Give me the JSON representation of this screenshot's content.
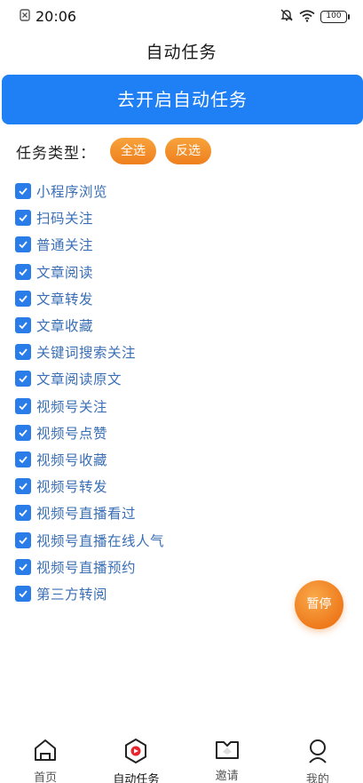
{
  "status_bar": {
    "time": "20:06",
    "battery": "100"
  },
  "header": {
    "title": "自动任务"
  },
  "start_button": {
    "label": "去开启自动任务"
  },
  "task_types": {
    "label": "任务类型：",
    "select_all": "全选",
    "invert": "反选"
  },
  "tasks": [
    {
      "label": "小程序浏览",
      "checked": true
    },
    {
      "label": "扫码关注",
      "checked": true
    },
    {
      "label": "普通关注",
      "checked": true
    },
    {
      "label": "文章阅读",
      "checked": true
    },
    {
      "label": "文章转发",
      "checked": true
    },
    {
      "label": "文章收藏",
      "checked": true
    },
    {
      "label": "关键词搜索关注",
      "checked": true
    },
    {
      "label": "文章阅读原文",
      "checked": true
    },
    {
      "label": "视频号关注",
      "checked": true
    },
    {
      "label": "视频号点赞",
      "checked": true
    },
    {
      "label": "视频号收藏",
      "checked": true
    },
    {
      "label": "视频号转发",
      "checked": true
    },
    {
      "label": "视频号直播看过",
      "checked": true
    },
    {
      "label": "视频号直播在线人气",
      "checked": true
    },
    {
      "label": "视频号直播预约",
      "checked": true
    },
    {
      "label": "第三方转阅",
      "checked": true
    }
  ],
  "pause_button": {
    "label": "暂停"
  },
  "bottom_nav": [
    {
      "label": "首页",
      "icon": "home-icon",
      "active": false
    },
    {
      "label": "自动任务",
      "icon": "auto-task-icon",
      "active": true
    },
    {
      "label": "邀请",
      "icon": "invite-icon",
      "active": false
    },
    {
      "label": "我的",
      "icon": "profile-icon",
      "active": false
    }
  ],
  "colors": {
    "primary": "#1f80f5",
    "accent_orange": "#ef7f1e",
    "checkbox": "#2a7de9",
    "task_text": "#3a6fb5",
    "active_icon_red": "#e8242c"
  }
}
